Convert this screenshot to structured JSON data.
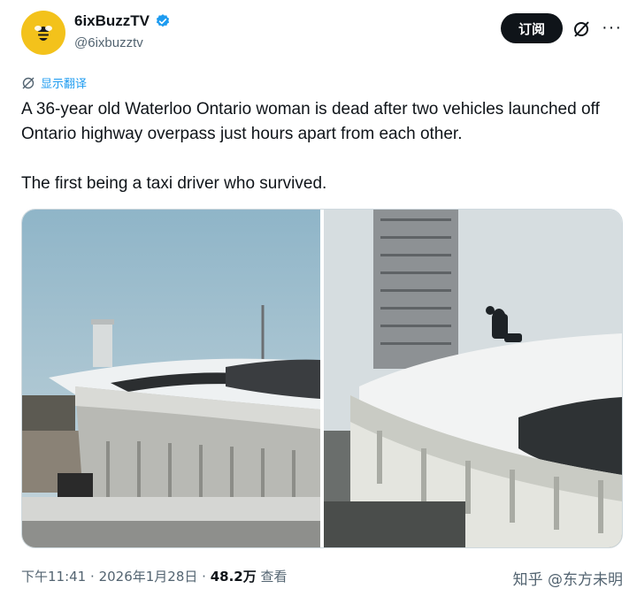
{
  "author": {
    "display_name": "6ixBuzzTV",
    "handle": "@6ixbuzztv",
    "verified": true,
    "avatar_color": "#f3c21b"
  },
  "actions": {
    "subscribe_label": "订阅",
    "grok_icon": "slash-circle-icon",
    "more_label": "···"
  },
  "translate": {
    "label": "显示翻译",
    "icon": "globe-icon"
  },
  "tweet": {
    "paragraphs": [
      "A 36-year old Waterloo Ontario woman is dead after two vehicles launched off Ontario highway overpass just hours apart from each other.",
      "The first being a taxi driver who survived."
    ]
  },
  "meta": {
    "time": "下午11:41",
    "sep1": "·",
    "date": "2026年1月28日",
    "sep2": "·",
    "views_count": "48.2万",
    "views_label": "查看"
  },
  "watermark": "知乎 @东方未明",
  "colors": {
    "link": "#1d9bf0",
    "text": "#0f1419",
    "muted": "#536471",
    "verified": "#1d9bf0"
  }
}
